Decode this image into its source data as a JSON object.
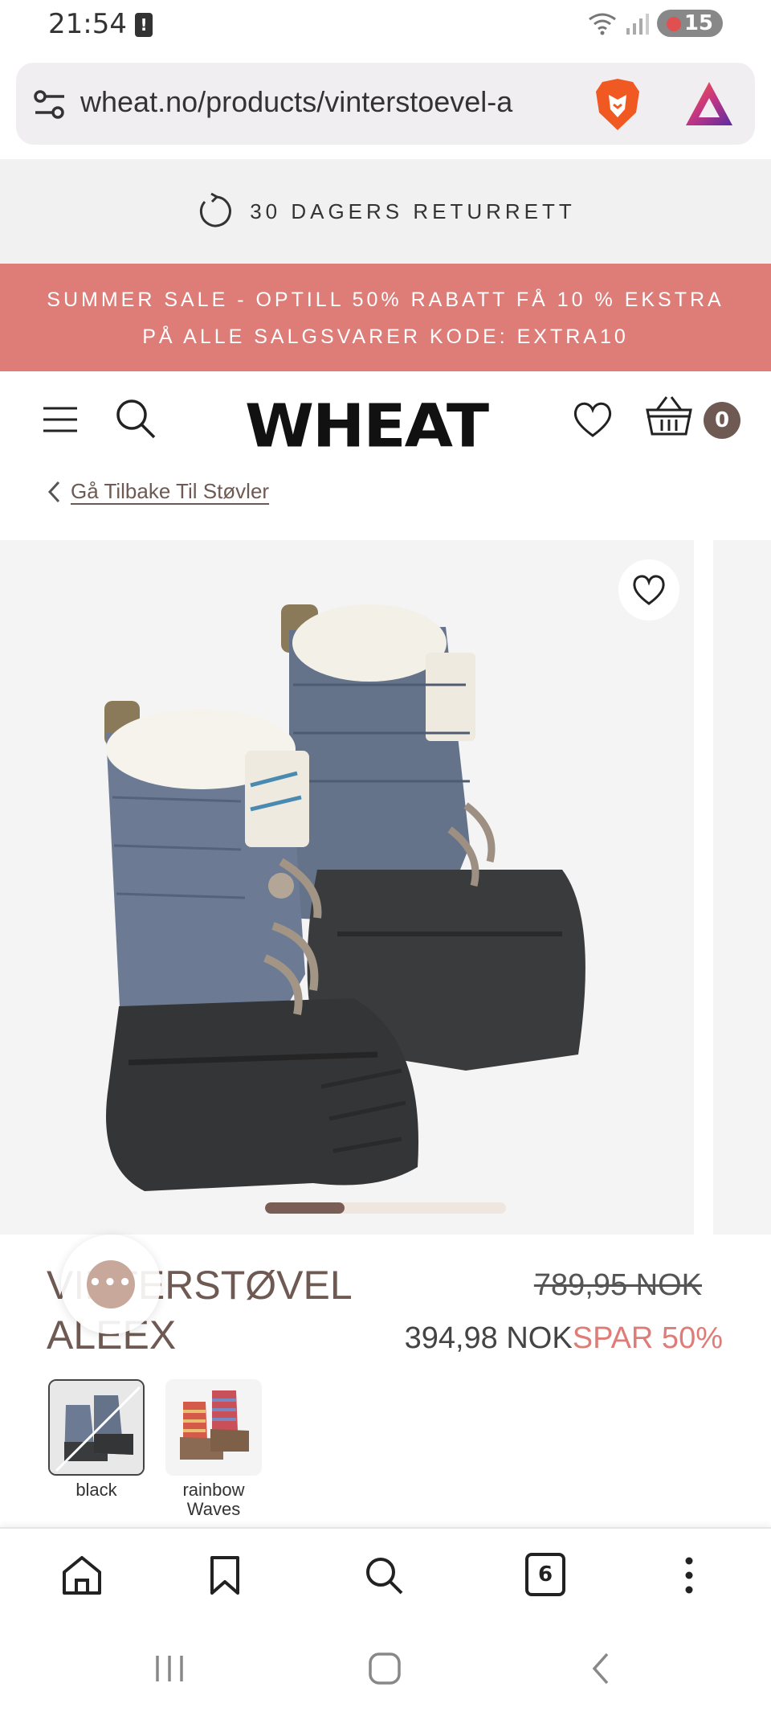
{
  "status_bar": {
    "time": "21:54",
    "notification_count": "15"
  },
  "browser": {
    "url": "wheat.no/products/vinterstoevel-a",
    "open_tabs": "6"
  },
  "store": {
    "returns_text": "30 DAGERS RETURRETT",
    "sale_line_1": "SUMMER SALE - OPTILL 50% RABATT FÅ 10 % EKSTRA",
    "sale_line_2": "PÅ ALLE SALGSVARER KODE: EXTRA10",
    "logo": "WHEAT",
    "cart_count": "0",
    "back_link": "Gå Tilbake Til Støvler"
  },
  "product": {
    "title_line_1": "VINTERSTØVEL",
    "title_line_2": "ALEEX",
    "old_price": "789,95 NOK",
    "new_price": "394,98 NOK",
    "discount": "SPAR 50%",
    "gallery_progress": 0.33,
    "swatches": [
      {
        "label": "black",
        "selected": true,
        "unavailable": true
      },
      {
        "label_1": "rainbow",
        "label_2": "Waves",
        "selected": false
      }
    ]
  },
  "colors": {
    "sale_banner": "#de7c78",
    "brand_brown": "#6e5a52",
    "discount": "#de7c78"
  },
  "icons": [
    "tune-icon",
    "brave-lion-icon",
    "rewards-triangle-icon",
    "refresh-icon",
    "menu-icon",
    "search-icon",
    "heart-icon",
    "basket-icon",
    "chevron-left-icon",
    "chat-icon",
    "home-icon",
    "bookmark-icon",
    "tabs-icon",
    "more-icon",
    "recents-icon",
    "home-nav-icon",
    "back-icon"
  ]
}
